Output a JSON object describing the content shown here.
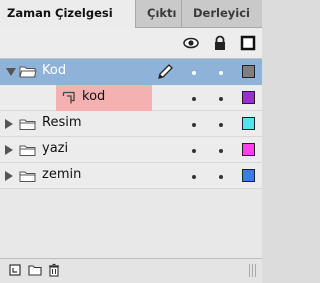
{
  "tabs": [
    {
      "label": "Zaman Çizelgesi"
    },
    {
      "label": "Çıktı"
    },
    {
      "label": "Derleyici"
    }
  ],
  "header_icons": [
    "eye-icon",
    "lock-icon",
    "outline-icon"
  ],
  "layers": [
    {
      "name": "Kod",
      "type": "folder",
      "expanded": true,
      "selected": true,
      "color": "#7f7f7f"
    },
    {
      "name": "kod",
      "type": "guide-layer",
      "parent": "Kod",
      "highlight": "#f4b1b1",
      "color": "#9b2fd1"
    },
    {
      "name": "Resim",
      "type": "folder",
      "expanded": false,
      "color": "#4ee6ea"
    },
    {
      "name": "yazi",
      "type": "folder",
      "expanded": false,
      "color": "#ff3ff0"
    },
    {
      "name": "zemin",
      "type": "folder",
      "expanded": false,
      "color": "#3a7de8"
    }
  ],
  "footer_icons": [
    "new-layer-icon",
    "new-folder-icon",
    "delete-icon"
  ]
}
